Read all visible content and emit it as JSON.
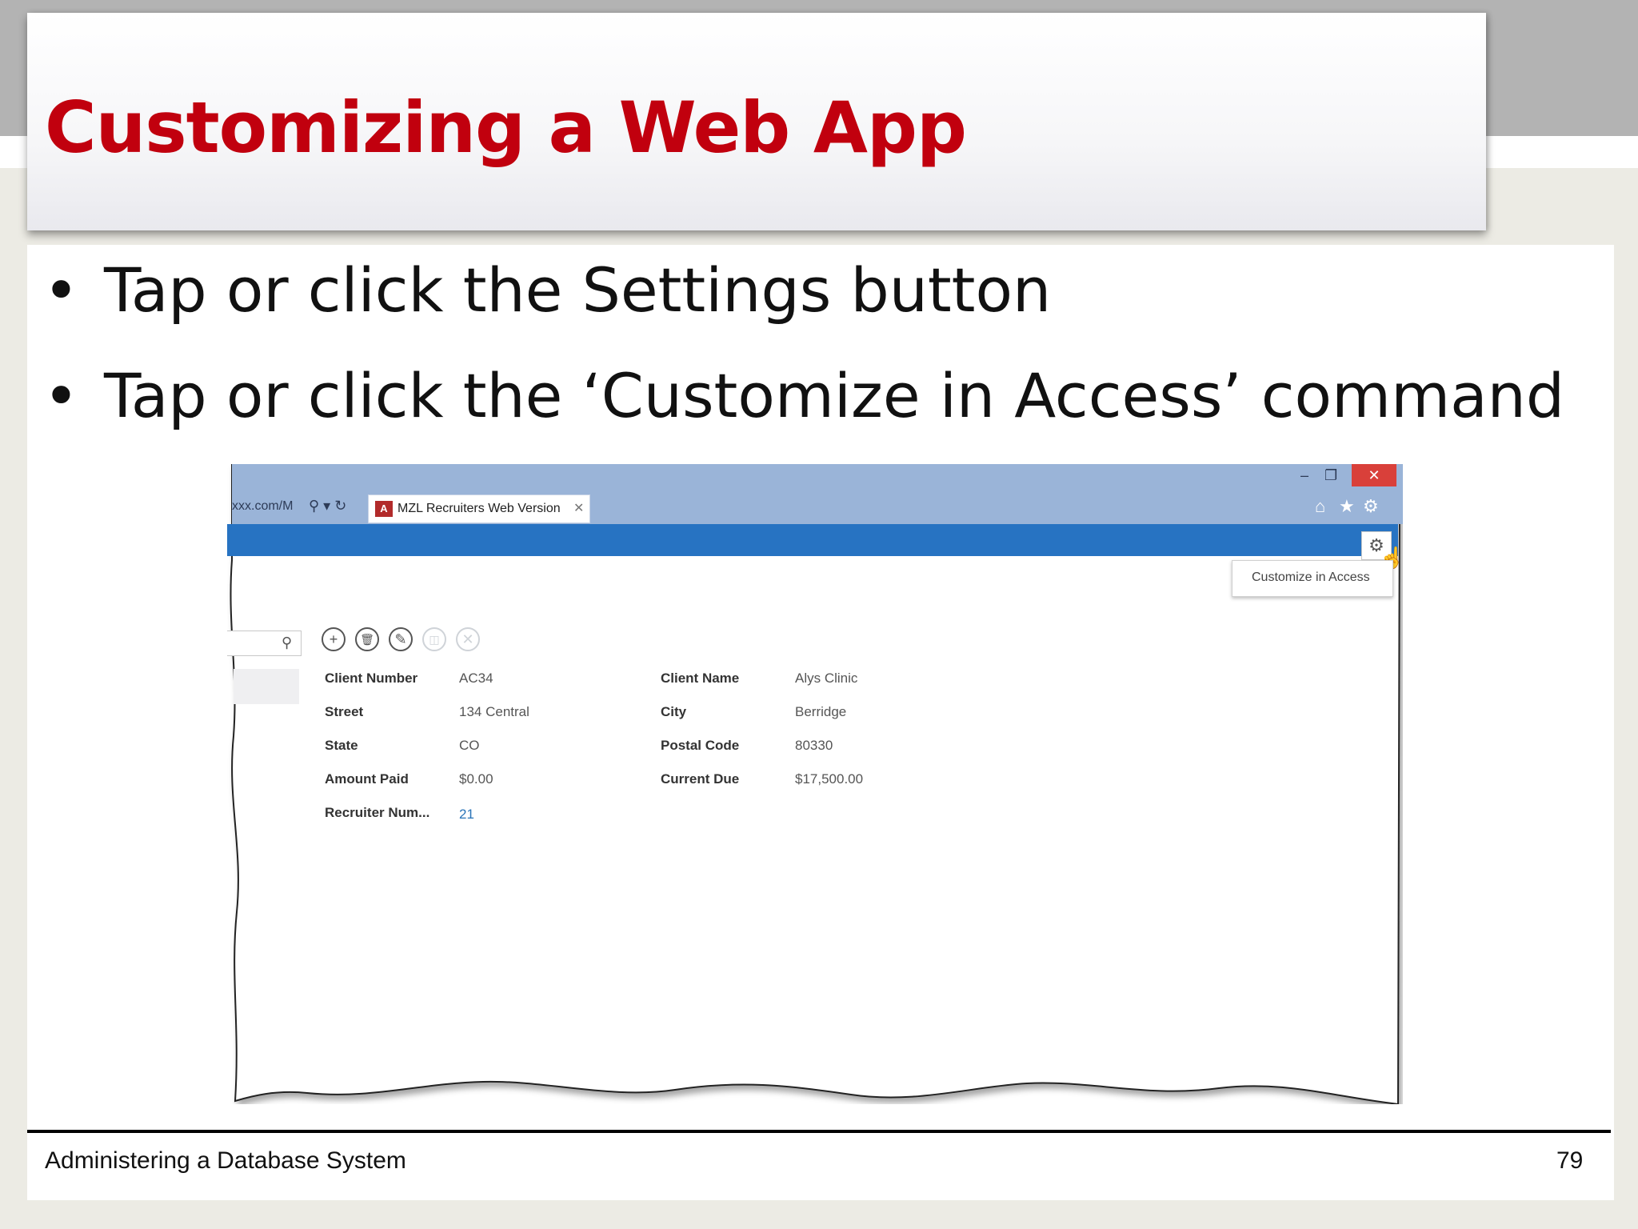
{
  "slide": {
    "title": "Customizing a Web App",
    "bullets": [
      {
        "text": "Tap or click the Settings button"
      },
      {
        "text": "Tap or click the ‘Customize in Access’ command"
      }
    ],
    "footer_left": "Administering a Database System",
    "page_number": "79",
    "bullet_char": "•"
  },
  "browser": {
    "url_fragment": "xxx.com/M",
    "tab_label": "MZL Recruiters Web Version",
    "tab_logo_text": "A",
    "menu_item": "Customize in Access",
    "glyphs": {
      "minimize": "–",
      "restore": "❐",
      "close": "✕",
      "tab_close": "✕",
      "url_tools": "⚲ ▾ ↻",
      "home": "⌂",
      "favorites": "★",
      "tools": "⚙",
      "settings": "⚙",
      "cursor": "☝",
      "search": "⚲",
      "add": "+",
      "delete": "🗑",
      "edit": "✎",
      "save": "◫",
      "cancel": "✕"
    }
  },
  "record": {
    "fields": [
      {
        "label": "Client Number",
        "value": "AC34"
      },
      {
        "label": "Street",
        "value": "134 Central"
      },
      {
        "label": "State",
        "value": "CO"
      },
      {
        "label": "Amount Paid",
        "value": "$0.00"
      },
      {
        "label": "Recruiter Num...",
        "value": "21"
      },
      {
        "label": "Client Name",
        "value": "Alys Clinic"
      },
      {
        "label": "City",
        "value": "Berridge"
      },
      {
        "label": "Postal Code",
        "value": "80330"
      },
      {
        "label": "Current Due",
        "value": "$17,500.00"
      }
    ]
  },
  "colors": {
    "title": "#c1000e",
    "browser_bar": "#2773c2",
    "close_button": "#d9403a",
    "link": "#2a74b8"
  }
}
